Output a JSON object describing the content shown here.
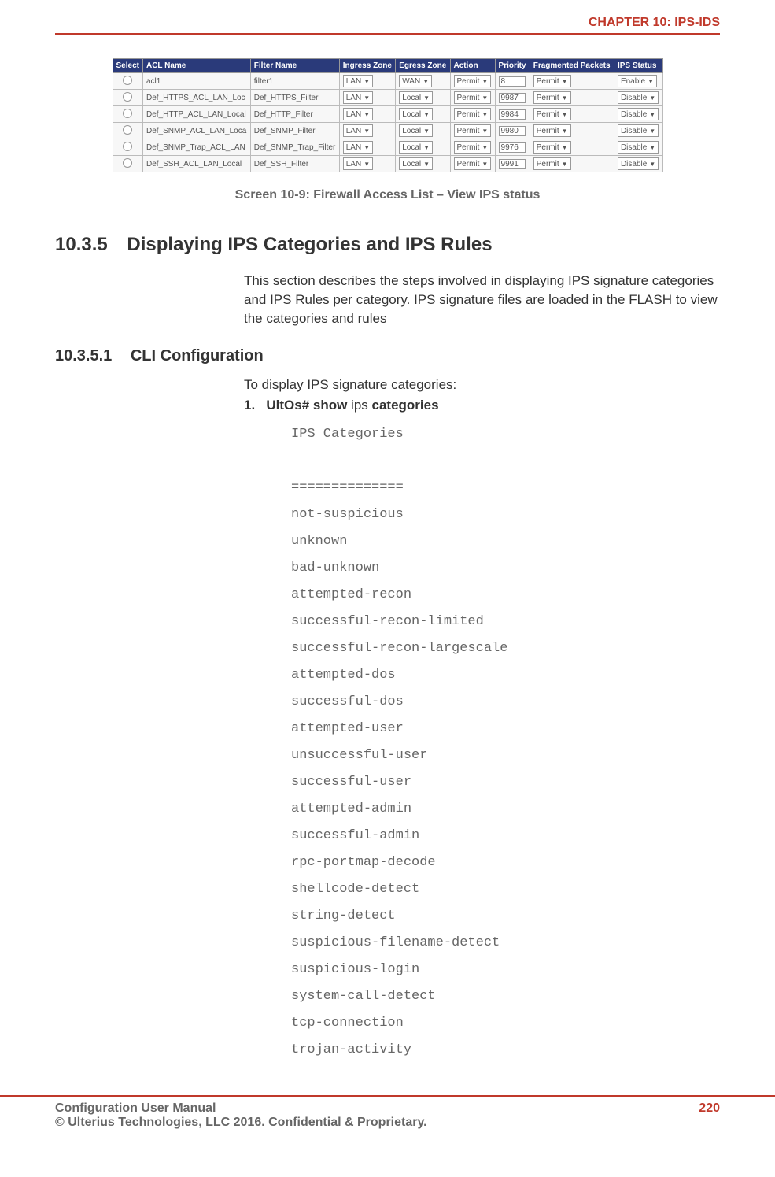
{
  "header": {
    "chapter": "CHAPTER 10: IPS-IDS"
  },
  "acl_table": {
    "headers": [
      "Select",
      "ACL Name",
      "Filter Name",
      "Ingress Zone",
      "Egress Zone",
      "Action",
      "Priority",
      "Fragmented Packets",
      "IPS Status"
    ],
    "rows": [
      {
        "acl": "acl1",
        "filter": "filter1",
        "ingress": "LAN",
        "egress": "WAN",
        "action": "Permit",
        "priority": "8",
        "frag": "Permit",
        "ips": "Enable"
      },
      {
        "acl": "Def_HTTPS_ACL_LAN_Loc",
        "filter": "Def_HTTPS_Filter",
        "ingress": "LAN",
        "egress": "Local",
        "action": "Permit",
        "priority": "9987",
        "frag": "Permit",
        "ips": "Disable"
      },
      {
        "acl": "Def_HTTP_ACL_LAN_Local",
        "filter": "Def_HTTP_Filter",
        "ingress": "LAN",
        "egress": "Local",
        "action": "Permit",
        "priority": "9984",
        "frag": "Permit",
        "ips": "Disable"
      },
      {
        "acl": "Def_SNMP_ACL_LAN_Loca",
        "filter": "Def_SNMP_Filter",
        "ingress": "LAN",
        "egress": "Local",
        "action": "Permit",
        "priority": "9980",
        "frag": "Permit",
        "ips": "Disable"
      },
      {
        "acl": "Def_SNMP_Trap_ACL_LAN",
        "filter": "Def_SNMP_Trap_Filter",
        "ingress": "LAN",
        "egress": "Local",
        "action": "Permit",
        "priority": "9976",
        "frag": "Permit",
        "ips": "Disable"
      },
      {
        "acl": "Def_SSH_ACL_LAN_Local",
        "filter": "Def_SSH_Filter",
        "ingress": "LAN",
        "egress": "Local",
        "action": "Permit",
        "priority": "9991",
        "frag": "Permit",
        "ips": "Disable"
      }
    ]
  },
  "caption": "Screen 10-9: Firewall Access List – View IPS status",
  "section": {
    "num": "10.3.5",
    "title": "Displaying IPS Categories and IPS Rules",
    "body": "This section describes the steps involved in displaying IPS signature categories and IPS Rules per category. IPS signature files are loaded in the FLASH to view the categories and rules"
  },
  "subsection": {
    "num": "10.3.5.1",
    "title": "CLI Configuration",
    "instr": "To display IPS signature categories:",
    "step_num": "1.",
    "step_prefix": "UltOs# show",
    "step_mid": " ips ",
    "step_suffix": "categories"
  },
  "code": {
    "heading": "IPS Categories",
    "sep": " ==============",
    "lines": [
      "not-suspicious",
      "unknown",
      "bad-unknown",
      "attempted-recon",
      "successful-recon-limited",
      "successful-recon-largescale",
      "attempted-dos",
      "successful-dos",
      "attempted-user",
      "unsuccessful-user",
      "successful-user",
      "attempted-admin",
      "successful-admin",
      "rpc-portmap-decode",
      "shellcode-detect",
      "string-detect",
      "suspicious-filename-detect",
      "suspicious-login",
      "system-call-detect",
      "tcp-connection",
      "trojan-activity"
    ]
  },
  "footer": {
    "line1": "Configuration User Manual",
    "line2": "© Ulterius Technologies, LLC 2016. Confidential & Proprietary.",
    "page": "220"
  }
}
